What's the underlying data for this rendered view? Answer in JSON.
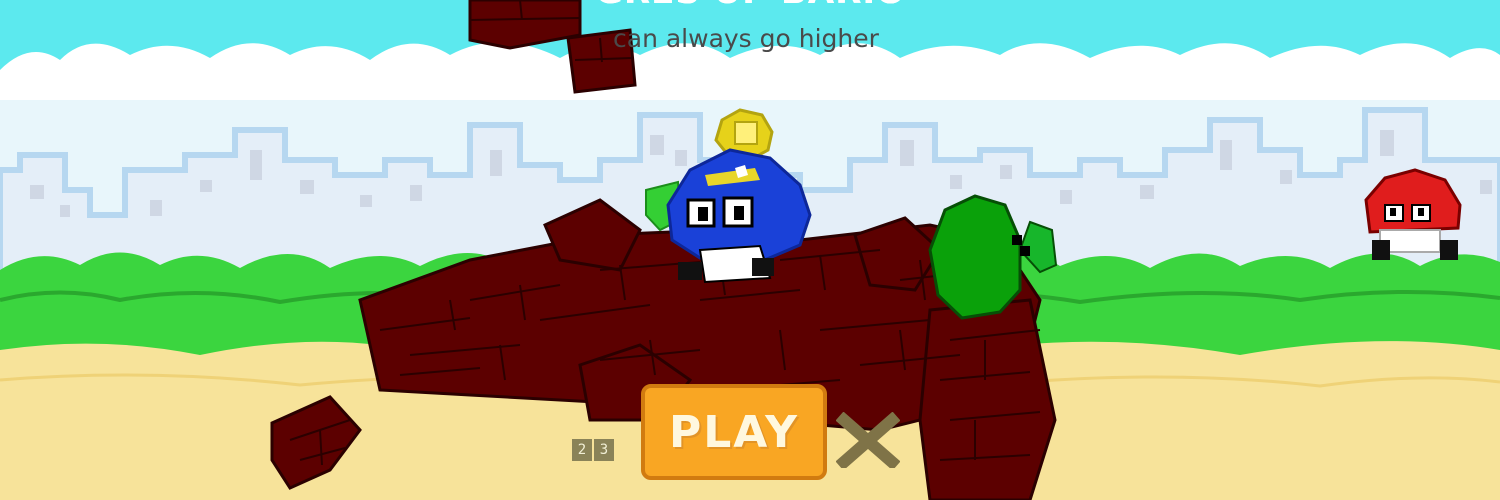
{
  "game": {
    "title": "GRES UP BARIO",
    "subtitle": "can always go higher",
    "play_label": "PLAY",
    "counters": [
      "2",
      "3"
    ],
    "close_symbol": "×"
  },
  "colors": {
    "sky": "#5ce9ee",
    "bush": "#3bd53f",
    "sand": "#f7e39a",
    "brick": "#5c0000",
    "play_button": "#f9a623",
    "hero": "#1a41d8",
    "goblin": "#e01d1d"
  },
  "icons": [
    "player-icon",
    "enemy-icon",
    "coin-icon",
    "brick-icon",
    "close-icon"
  ]
}
